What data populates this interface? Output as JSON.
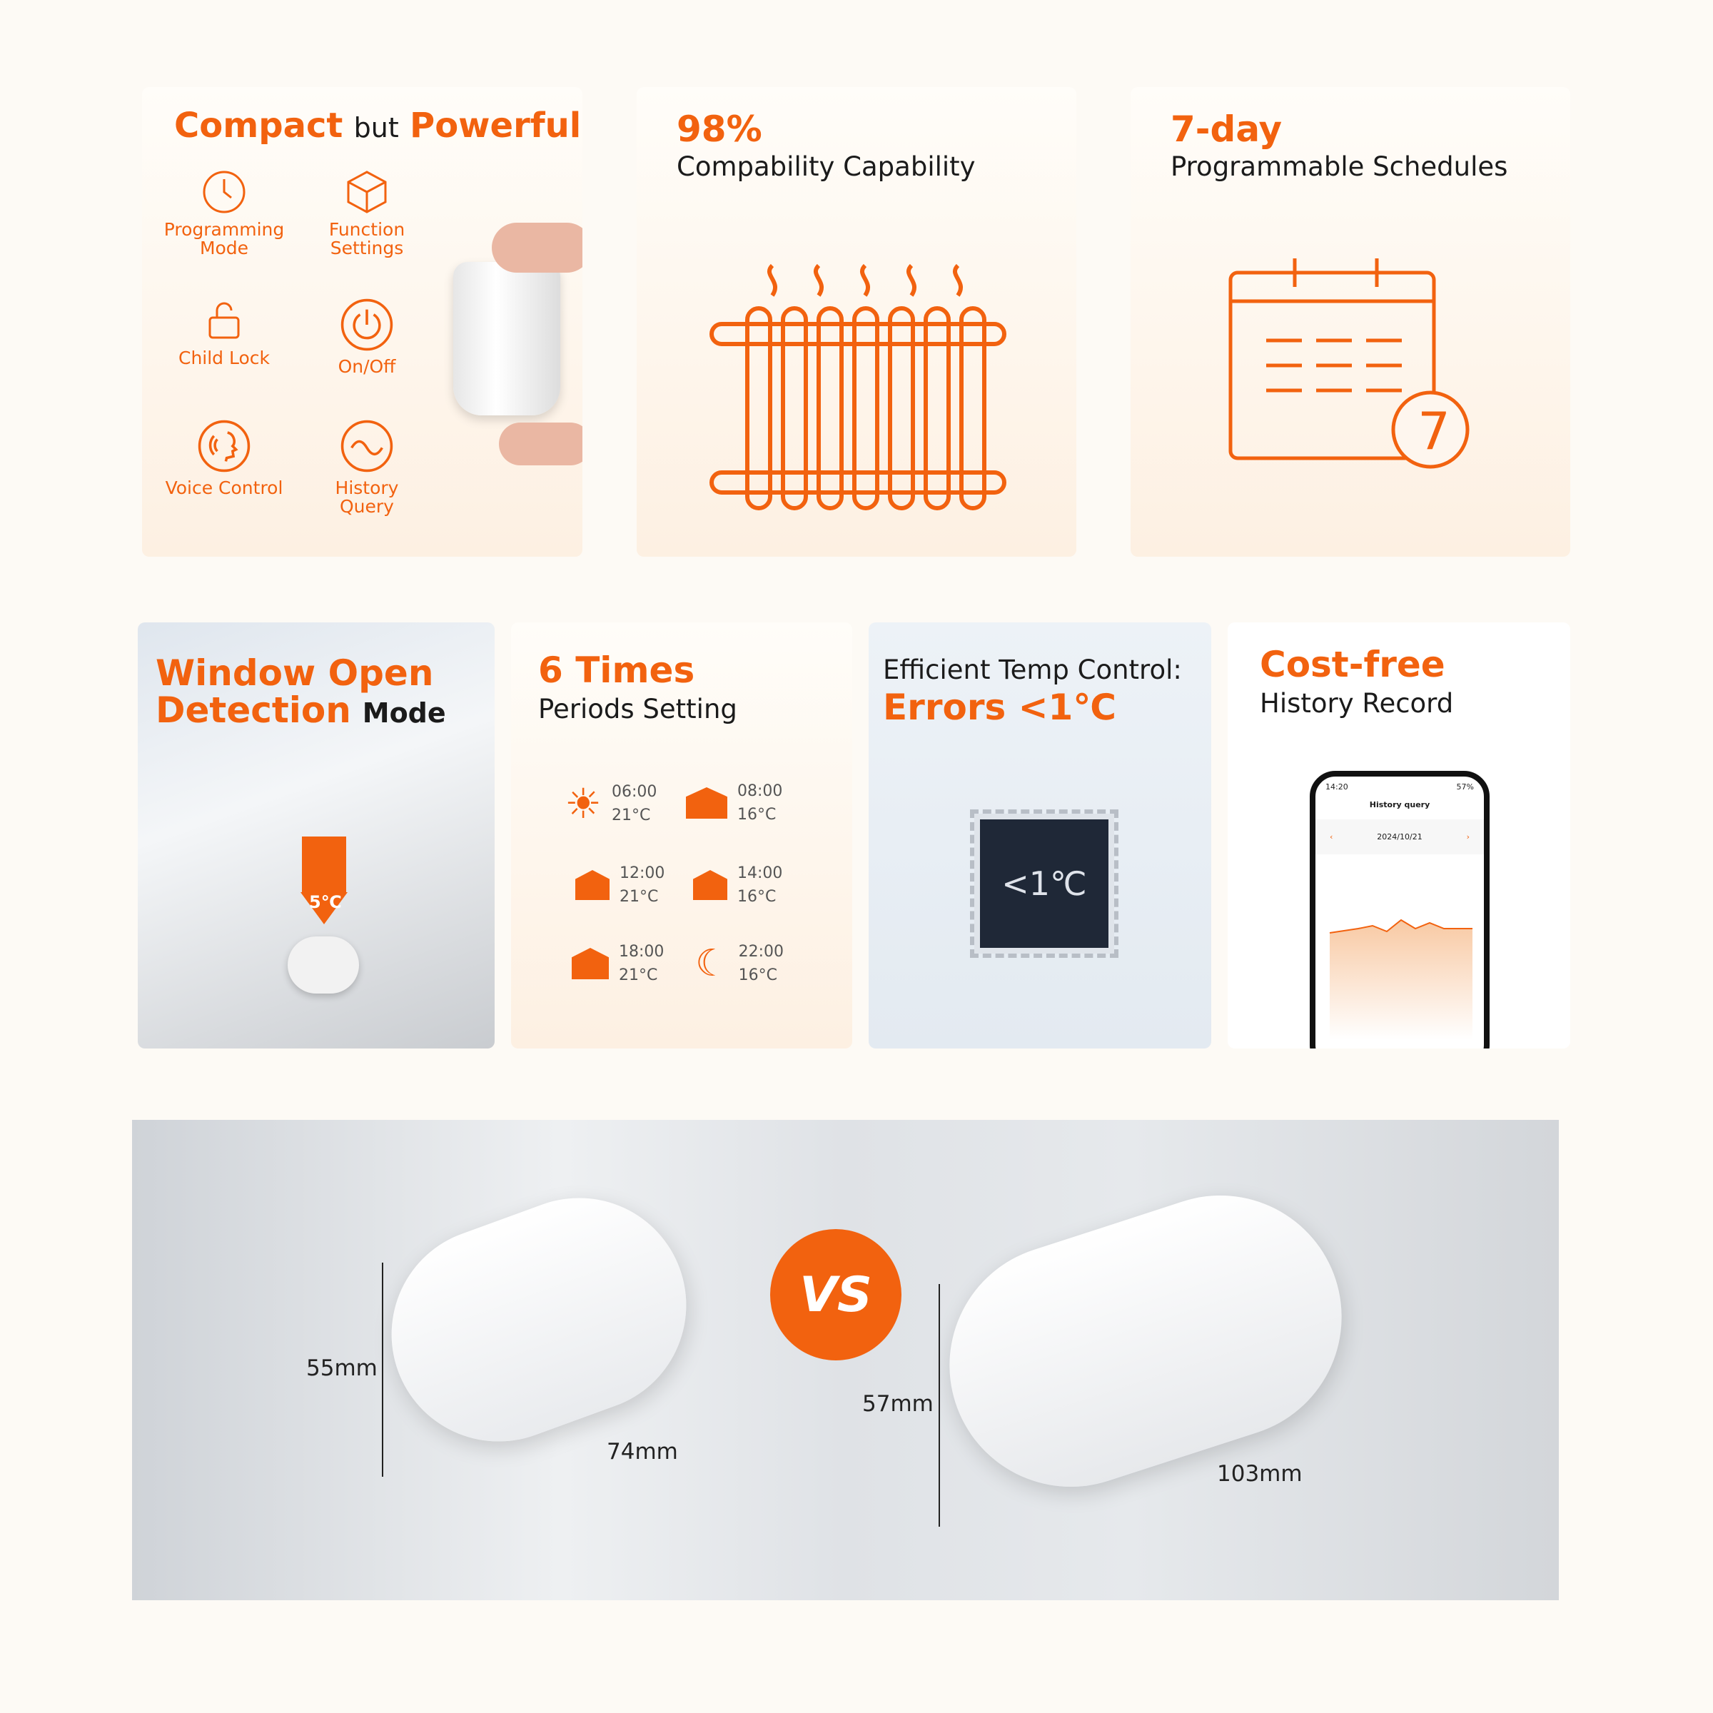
{
  "card_compact": {
    "title_a": "Compact",
    "title_b": "but",
    "title_c": "Powerful",
    "features": [
      {
        "label": "Programming Mode",
        "icon": "clock-icon"
      },
      {
        "label": "Function Settings",
        "icon": "cube-icon"
      },
      {
        "label": "Child Lock",
        "icon": "lock-icon"
      },
      {
        "label": "On/Off",
        "icon": "power-icon"
      },
      {
        "label": "Voice Control",
        "icon": "voice-icon"
      },
      {
        "label": "History Query",
        "icon": "wave-icon"
      }
    ]
  },
  "card_compat": {
    "value": "98%",
    "label": "Compability Capability"
  },
  "card_schedule": {
    "value": "7-day",
    "label": "Programmable Schedules",
    "badge": "7"
  },
  "card_window": {
    "title_a": "Window Open",
    "title_b": "Detection",
    "title_c": "Mode",
    "temp": "5℃"
  },
  "card_periods": {
    "value": "6 Times",
    "label": "Periods Setting",
    "periods": [
      {
        "time": "06:00",
        "temp": "21°C",
        "icon": "sun-icon"
      },
      {
        "time": "08:00",
        "temp": "16°C",
        "icon": "leave-home-icon"
      },
      {
        "time": "12:00",
        "temp": "21°C",
        "icon": "lunch-home-icon"
      },
      {
        "time": "14:00",
        "temp": "16°C",
        "icon": "lunch-leave-icon"
      },
      {
        "time": "18:00",
        "temp": "21°C",
        "icon": "return-home-icon"
      },
      {
        "time": "22:00",
        "temp": "16°C",
        "icon": "moon-icon"
      }
    ]
  },
  "card_temp": {
    "label": "Efficient Temp Control:",
    "value": "Errors <1℃",
    "chip": "<1℃"
  },
  "card_history": {
    "value": "Cost-free",
    "label": "History Record",
    "phone": {
      "time": "14:20",
      "battery": "57%",
      "title": "History query",
      "date": "2024/10/21"
    }
  },
  "compare": {
    "vs": "VS",
    "left": {
      "height": "55mm",
      "length": "74mm"
    },
    "right": {
      "height": "57mm",
      "length": "103mm"
    }
  },
  "colors": {
    "accent": "#f2620f",
    "background": "#fdfaf5"
  }
}
